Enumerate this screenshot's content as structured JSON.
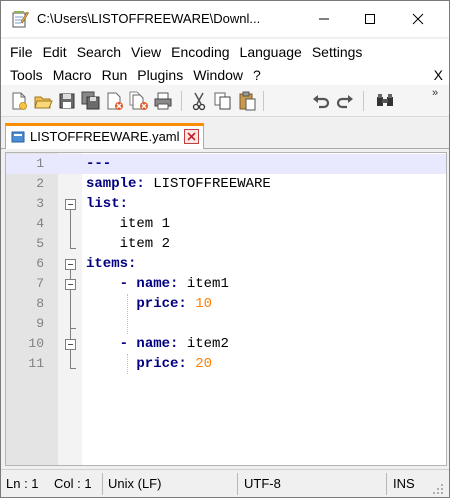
{
  "window": {
    "title": "C:\\Users\\LISTOFFREEWARE\\Downl...",
    "minimize_icon": "minimize-icon",
    "maximize_icon": "maximize-icon",
    "close_icon": "close-icon"
  },
  "menu": {
    "row1": [
      "File",
      "Edit",
      "Search",
      "View",
      "Encoding",
      "Language",
      "Settings"
    ],
    "row2": [
      "Tools",
      "Macro",
      "Run",
      "Plugins",
      "Window",
      "?"
    ],
    "close_doc": "X"
  },
  "toolbar": {
    "buttons": [
      "new-file-icon",
      "open-file-icon",
      "save-icon",
      "save-all-icon",
      "close-icon",
      "close-all-icon",
      "print-icon",
      "cut-icon",
      "copy-icon",
      "paste-icon",
      "undo-icon",
      "redo-icon",
      "find-icon"
    ],
    "more": "»"
  },
  "tab": {
    "label": "LISTOFFREEWARE.yaml",
    "icon": "file-icon",
    "close_icon": "tab-close-icon",
    "accent": "#fa8c00"
  },
  "editor": {
    "lines": [
      {
        "num": "1",
        "text": "---"
      },
      {
        "num": "2",
        "key": "sample:",
        "value": " LISTOFFREEWARE"
      },
      {
        "num": "3",
        "key": "list:"
      },
      {
        "num": "4",
        "value": "    item 1"
      },
      {
        "num": "5",
        "value": "    item 2"
      },
      {
        "num": "6",
        "key": "items:"
      },
      {
        "num": "7",
        "dash": "    - ",
        "key": "name:",
        "value": " item1"
      },
      {
        "num": "8",
        "key": "      price:",
        "number": " 10"
      },
      {
        "num": "9"
      },
      {
        "num": "10",
        "dash": "    - ",
        "key": "name:",
        "value": " item2"
      },
      {
        "num": "11",
        "key": "      price:",
        "number": " 20"
      }
    ],
    "colors": {
      "keyword": "#000080",
      "number": "#ff8000",
      "current_line": "#e8e8ff"
    }
  },
  "status": {
    "line": "Ln : 1",
    "col": "Col : 1",
    "eol": "Unix (LF)",
    "encoding": "UTF-8",
    "mode": "INS"
  }
}
